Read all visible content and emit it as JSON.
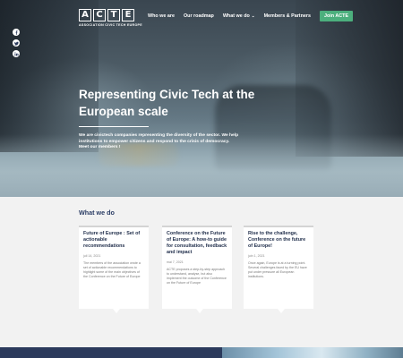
{
  "header": {
    "logo_letters": [
      "A",
      "C",
      "T",
      "E"
    ],
    "logo_subtitle": "ASSOCIATION CIVIC TECH EUROPE",
    "nav": {
      "who_we_are": "Who we are",
      "roadmap": "Our roadmap",
      "what_we_do": "What we do",
      "members": "Members & Partners",
      "join": "Join ACTE"
    }
  },
  "social": [
    "facebook-icon",
    "twitter-icon",
    "linkedin-icon"
  ],
  "hero": {
    "title": "Representing Civic Tech at the European scale",
    "description": "We are civictech companies representing the diversity of the sector. We help institutions to empower citizens and respond to the crisis of democracy. Meet our members !"
  },
  "section": {
    "title": "What we do",
    "cards": [
      {
        "title": "Future of Europe : Set of actionable recommendations",
        "date": "juil 14, 2021",
        "excerpt": "The members of the association wrote a set of actionable recommendations to highlight some of the main objectives of the Conference on the Future of Europe"
      },
      {
        "title": "Conference on the Future of Europe: A how-to guide for consultation, feedback and impact",
        "date": "mai 7, 2021",
        "excerpt": "ACTE proposes a step-by-step approach to understand, analyse, but also implement the outcome of the Conference on the Future of Europe"
      },
      {
        "title": "Rise to the challenge, Conference on the future of Europe!",
        "date": "juin 1, 2021",
        "excerpt": "Once again, Europe is at a turning point. Several challenges faced by the EU have put under pressure all European institutions."
      }
    ]
  },
  "colors": {
    "accent_green": "#4caf7d",
    "heading_navy": "#2c3e66",
    "footer_navy": "#2b3a5c"
  }
}
